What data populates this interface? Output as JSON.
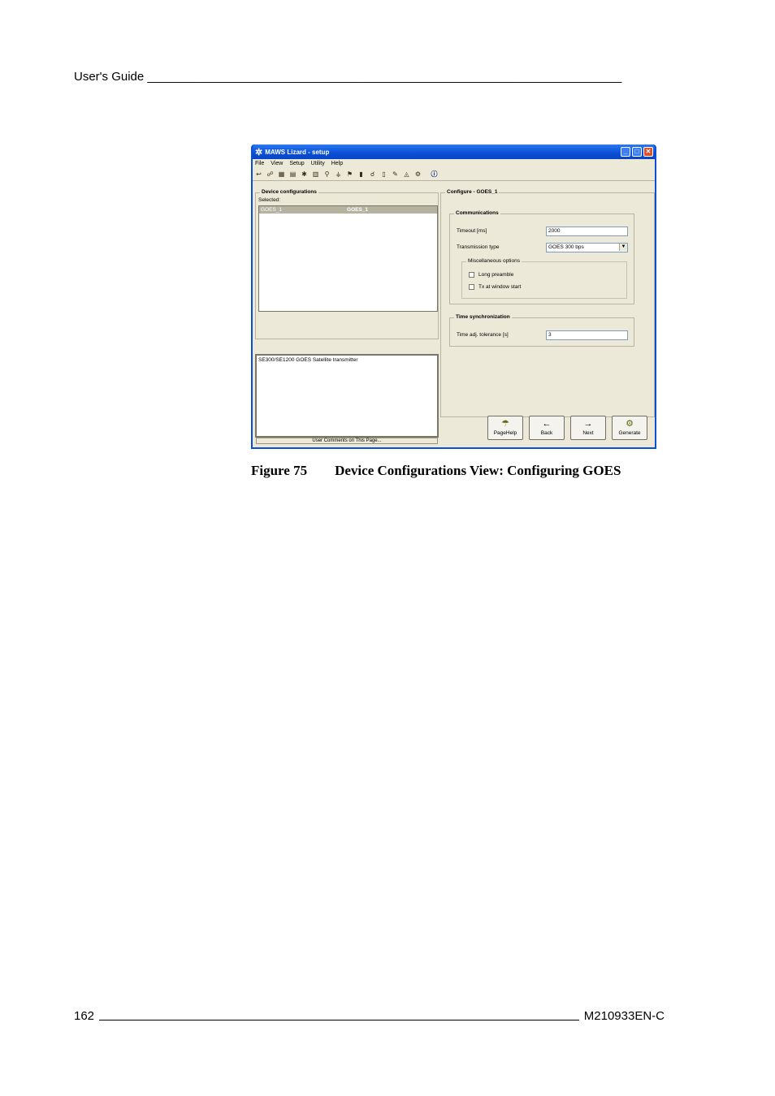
{
  "header": {
    "title": "User's Guide",
    "rule": "______________________________________________________________________"
  },
  "window": {
    "title": "MAWS Lizard - setup",
    "app_icon": "lizard-icon",
    "menus": [
      "File",
      "View",
      "Setup",
      "Utility",
      "Help"
    ],
    "left": {
      "device_group_title": "Device configurations",
      "selected_label": "Selected:",
      "list_items": [
        {
          "col1": "GOES_1",
          "col2": "GOES_1"
        }
      ],
      "description": "SE300/SE1200 GOES Satellite transmitter",
      "comments_bar": "User Comments on This Page..."
    },
    "right": {
      "configure_title": "Configure - GOES_1",
      "communications": {
        "title": "Communications",
        "timeout_label": "Timeout [ms]",
        "timeout_value": "2000",
        "transmission_label": "Transmission type",
        "transmission_value": "GOES 300 bps",
        "misc_title": "Miscellaneous options",
        "long_preamble": "Long preamble",
        "tx_window": "Tx at window start"
      },
      "time_sync": {
        "title": "Time synchronization",
        "tolerance_label": "Time adj. tolerance [s]",
        "tolerance_value": "3"
      }
    },
    "buttons": {
      "pagehelp": "PageHelp",
      "back": "Back",
      "next": "Next",
      "generate": "Generate"
    }
  },
  "caption": {
    "number": "Figure 75",
    "title": "Device Configurations View: Configuring GOES"
  },
  "footer": {
    "page_number": "162",
    "doc_code": "M210933EN-C"
  }
}
